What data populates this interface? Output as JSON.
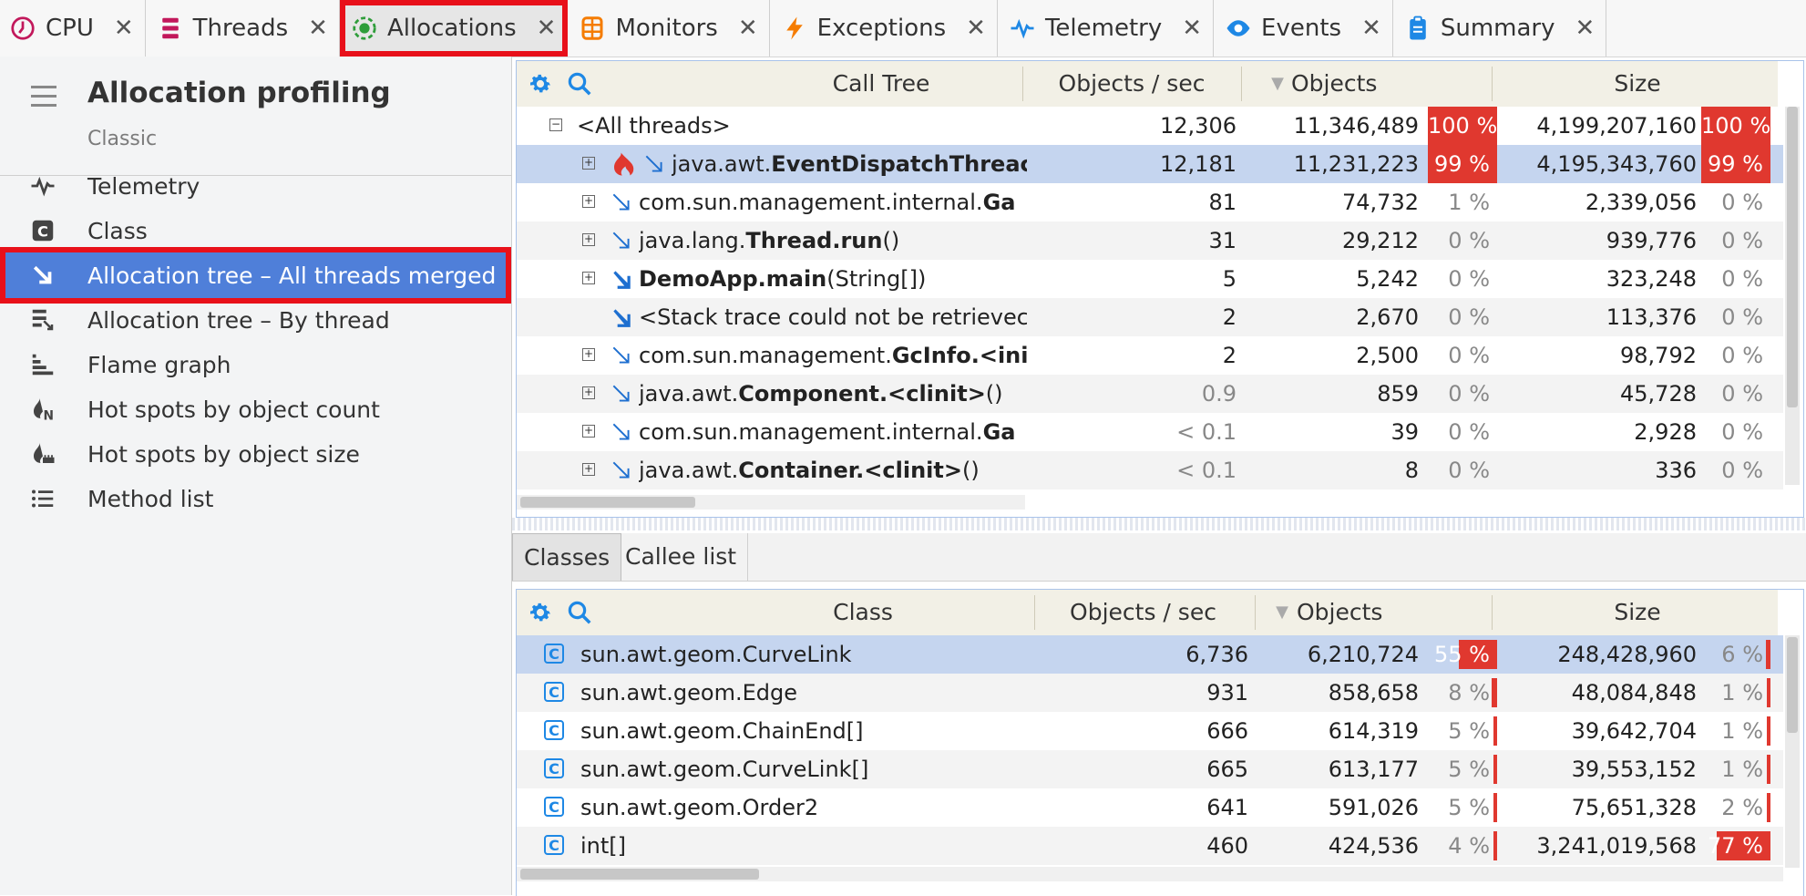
{
  "tabs": [
    {
      "label": "CPU",
      "icon": "clock-icon",
      "color": "#c2185b"
    },
    {
      "label": "Threads",
      "icon": "threads-icon",
      "color": "#c2185b"
    },
    {
      "label": "Allocations",
      "icon": "allocations-icon",
      "color": "#2e9d3a",
      "active": true
    },
    {
      "label": "Monitors",
      "icon": "monitors-icon",
      "color": "#f57c00"
    },
    {
      "label": "Exceptions",
      "icon": "lightning-icon",
      "color": "#f57c00"
    },
    {
      "label": "Telemetry",
      "icon": "pulse-icon",
      "color": "#1e88e5"
    },
    {
      "label": "Events",
      "icon": "eye-icon",
      "color": "#1e88e5"
    },
    {
      "label": "Summary",
      "icon": "clipboard-icon",
      "color": "#1e88e5"
    }
  ],
  "tab_close": "✕",
  "sidebar": {
    "title": "Allocation profiling",
    "subtitle": "Classic",
    "items": [
      {
        "label": "Telemetry",
        "icon": "pulse-icon"
      },
      {
        "label": "Class",
        "icon": "class-icon"
      },
      {
        "label": "Allocation tree – All threads merged",
        "icon": "allocation-arrow-icon",
        "selected": true
      },
      {
        "label": "Allocation tree – By thread",
        "icon": "allocation-thread-icon"
      },
      {
        "label": "Flame graph",
        "icon": "flame-graph-icon"
      },
      {
        "label": "Hot spots by object count",
        "icon": "hotspot-count-icon"
      },
      {
        "label": "Hot spots by object size",
        "icon": "hotspot-size-icon"
      },
      {
        "label": "Method list",
        "icon": "list-icon"
      }
    ]
  },
  "call_tree": {
    "headers": {
      "name": "Call Tree",
      "rate": "Objects / sec",
      "objects": "Objects",
      "size": "Size"
    },
    "rows": [
      {
        "prefix": "",
        "name": "<All threads>",
        "suffix": "",
        "rate": "12,306",
        "objects": "11,346,489",
        "obj_pct": "100 %",
        "size": "4,199,207,160",
        "size_pct": "100 %",
        "level": 0,
        "expander": "minus",
        "hot": true
      },
      {
        "prefix": "java.awt.",
        "name": "EventDispatchThreac",
        "suffix": "",
        "rate": "12,181",
        "objects": "11,231,223",
        "obj_pct": "99 %",
        "size": "4,195,343,760",
        "size_pct": "99 %",
        "level": 1,
        "expander": "plus",
        "hot": true,
        "selected": true,
        "hotspot": true
      },
      {
        "prefix": "com.sun.management.internal.",
        "name": "Ga",
        "suffix": "",
        "rate": "81",
        "objects": "74,732",
        "obj_pct": "1 %",
        "size": "2,339,056",
        "size_pct": "0 %",
        "level": 1,
        "expander": "plus"
      },
      {
        "prefix": "java.lang.",
        "name": "Thread.run",
        "suffix": "()",
        "rate": "31",
        "objects": "29,212",
        "obj_pct": "0 %",
        "size": "939,776",
        "size_pct": "0 %",
        "level": 1,
        "expander": "plus"
      },
      {
        "prefix": "",
        "name": "DemoApp.main",
        "suffix": "(String[])",
        "rate": "5",
        "objects": "5,242",
        "obj_pct": "0 %",
        "size": "323,248",
        "size_pct": "0 %",
        "level": 1,
        "expander": "plus",
        "filled": true
      },
      {
        "prefix": "",
        "name": "",
        "suffix": "<Stack trace could not be retrievec",
        "rate": "2",
        "objects": "2,670",
        "obj_pct": "0 %",
        "size": "113,376",
        "size_pct": "0 %",
        "level": 1,
        "expander": "none",
        "filled": true
      },
      {
        "prefix": "com.sun.management.",
        "name": "GcInfo.<ini",
        "suffix": "",
        "rate": "2",
        "objects": "2,500",
        "obj_pct": "0 %",
        "size": "98,792",
        "size_pct": "0 %",
        "level": 1,
        "expander": "plus"
      },
      {
        "prefix": "java.awt.",
        "name": "Component.<clinit>",
        "suffix": "()",
        "rate": "0.9",
        "objects": "859",
        "obj_pct": "0 %",
        "size": "45,728",
        "size_pct": "0 %",
        "level": 1,
        "expander": "plus",
        "dim_rate": true
      },
      {
        "prefix": "com.sun.management.internal.",
        "name": "Ga",
        "suffix": "",
        "rate": "< 0.1",
        "objects": "39",
        "obj_pct": "0 %",
        "size": "2,928",
        "size_pct": "0 %",
        "level": 1,
        "expander": "plus",
        "dim_rate": true
      },
      {
        "prefix": "java.awt.",
        "name": "Container.<clinit>",
        "suffix": "()",
        "rate": "< 0.1",
        "objects": "8",
        "obj_pct": "0 %",
        "size": "336",
        "size_pct": "0 %",
        "level": 1,
        "expander": "plus",
        "dim_rate": true
      }
    ]
  },
  "sub_tabs": [
    "Classes",
    "Callee list"
  ],
  "classes": {
    "headers": {
      "name": "Class",
      "rate": "Objects / sec",
      "objects": "Objects",
      "size": "Size"
    },
    "rows": [
      {
        "name": "sun.awt.geom.CurveLink",
        "rate": "6,736",
        "objects": "6,210,724",
        "obj_pct": "55 %",
        "obj_frac": 0.55,
        "size": "248,428,960",
        "size_pct": "6 %",
        "size_frac": 0.06,
        "selected": true
      },
      {
        "name": "sun.awt.geom.Edge",
        "rate": "931",
        "objects": "858,658",
        "obj_pct": "8 %",
        "obj_frac": 0.08,
        "size": "48,084,848",
        "size_pct": "1 %",
        "size_frac": 0.01
      },
      {
        "name": "sun.awt.geom.ChainEnd[]",
        "rate": "666",
        "objects": "614,319",
        "obj_pct": "5 %",
        "obj_frac": 0.05,
        "size": "39,642,704",
        "size_pct": "1 %",
        "size_frac": 0.01
      },
      {
        "name": "sun.awt.geom.CurveLink[]",
        "rate": "665",
        "objects": "613,177",
        "obj_pct": "5 %",
        "obj_frac": 0.05,
        "size": "39,553,152",
        "size_pct": "1 %",
        "size_frac": 0.01
      },
      {
        "name": "sun.awt.geom.Order2",
        "rate": "641",
        "objects": "591,026",
        "obj_pct": "5 %",
        "obj_frac": 0.05,
        "size": "75,651,328",
        "size_pct": "2 %",
        "size_frac": 0.02
      },
      {
        "name": "int[]",
        "rate": "460",
        "objects": "424,536",
        "obj_pct": "4 %",
        "obj_frac": 0.04,
        "size": "3,241,019,568",
        "size_pct": "77 %",
        "size_frac": 0.77
      }
    ]
  },
  "class_icon_letter": "C",
  "sort_arrow": "▼",
  "colors": {
    "accent": "#4f7fd9",
    "hot": "#e0382f",
    "highlight": "#e8101a",
    "selected_row": "#c5d5ef"
  }
}
